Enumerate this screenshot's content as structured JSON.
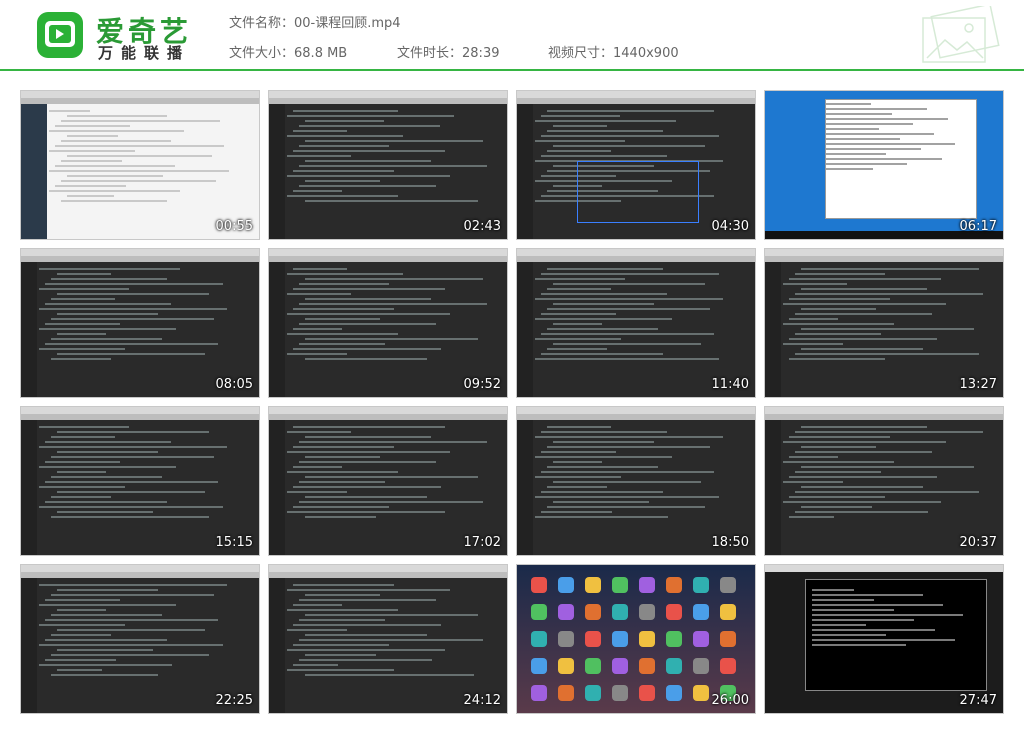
{
  "brand": {
    "name": "爱奇艺",
    "tagline": "万能联播"
  },
  "file": {
    "name_label": "文件名称：",
    "name": "00-课程回顾.mp4",
    "size_label": "文件大小：",
    "size": "68.8 MB",
    "duration_label": "文件时长：",
    "duration": "28:39",
    "dims_label": "视频尺寸：",
    "dims": "1440x900"
  },
  "colors": {
    "accent": "#2bb136",
    "divider": "#36b543"
  },
  "thumbnails": [
    {
      "time": "00:55",
      "kind": "web"
    },
    {
      "time": "02:43",
      "kind": "code"
    },
    {
      "time": "04:30",
      "kind": "code"
    },
    {
      "time": "06:17",
      "kind": "windows"
    },
    {
      "time": "08:05",
      "kind": "code"
    },
    {
      "time": "09:52",
      "kind": "code"
    },
    {
      "time": "11:40",
      "kind": "code"
    },
    {
      "time": "13:27",
      "kind": "code"
    },
    {
      "time": "15:15",
      "kind": "code"
    },
    {
      "time": "17:02",
      "kind": "code"
    },
    {
      "time": "18:50",
      "kind": "code"
    },
    {
      "time": "20:37",
      "kind": "code"
    },
    {
      "time": "22:25",
      "kind": "code"
    },
    {
      "time": "24:12",
      "kind": "code"
    },
    {
      "time": "26:00",
      "kind": "mac"
    },
    {
      "time": "27:47",
      "kind": "terminal"
    }
  ]
}
